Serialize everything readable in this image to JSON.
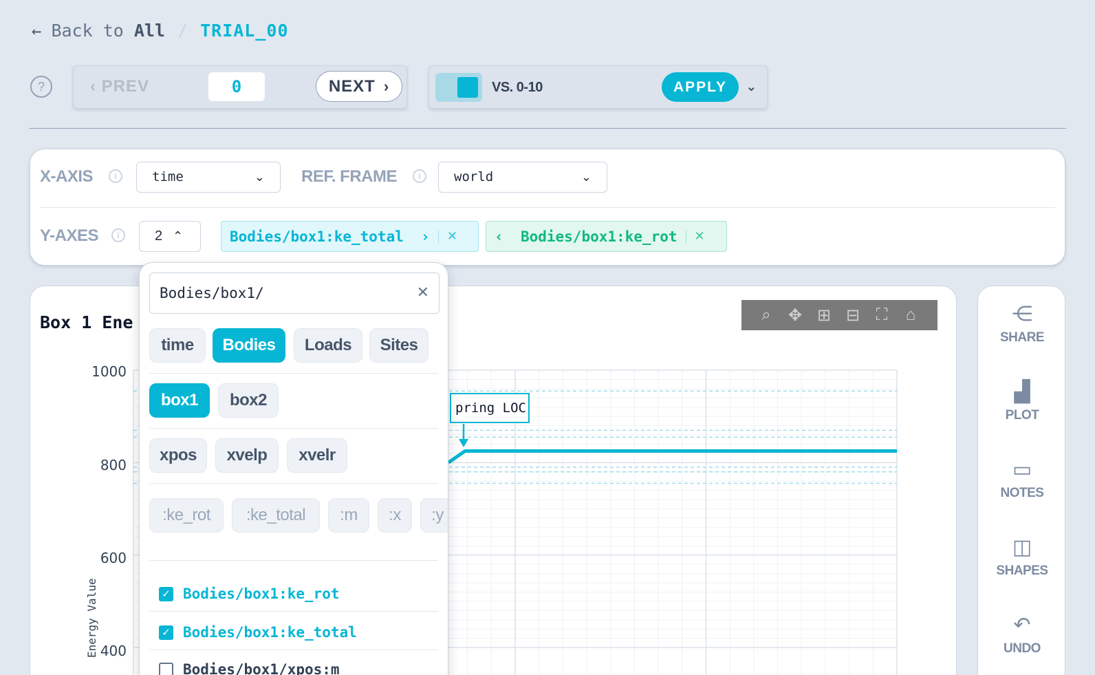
{
  "breadcrumb": {
    "back_prefix": "Back to",
    "back_target": "All",
    "separator": "/",
    "trial": "TRIAL_00"
  },
  "navigator": {
    "prev_label": "PREV",
    "index_value": "0",
    "next_label": "NEXT"
  },
  "compare": {
    "vs_label": "VS. 0-10",
    "apply_label": "APPLY"
  },
  "axes": {
    "x_label": "X-AXIS",
    "x_value": "time",
    "ref_label": "REF. FRAME",
    "ref_value": "world",
    "y_label": "Y-AXES",
    "y_count": "2",
    "y_tags": [
      "Bodies/box1:ke_total",
      "Bodies/box1:ke_rot"
    ]
  },
  "chart": {
    "title": "Box 1 Ene",
    "annotation": "pring LOC",
    "ylabel": "Energy Value",
    "yticks": [
      "1000",
      "800",
      "600",
      "400"
    ]
  },
  "chart_data": {
    "type": "line",
    "title": "Box 1 Ene",
    "ylabel": "Energy Value",
    "ylim": [
      400,
      1000
    ],
    "yticks": [
      1000,
      800,
      600,
      400
    ],
    "series": [
      {
        "values": [
          800,
          825,
          825,
          825,
          825,
          825
        ]
      }
    ]
  },
  "toolbar_icons": [
    "zoom-icon",
    "pan-icon",
    "zoom-in-icon",
    "zoom-out-icon",
    "autoscale-icon",
    "home-icon"
  ],
  "rail": {
    "share": "SHARE",
    "plot": "PLOT",
    "notes": "NOTES",
    "shapes": "SHAPES",
    "undo": "UNDO"
  },
  "dropdown": {
    "search_value": "Bodies/box1/",
    "level1": [
      "time",
      "Bodies",
      "Loads",
      "Sites"
    ],
    "level2": [
      "box1",
      "box2"
    ],
    "level3": [
      "xpos",
      "xvelp",
      "xvelr"
    ],
    "level4": [
      ":ke_rot",
      ":ke_total",
      ":m",
      ":x",
      ":y"
    ],
    "checks": [
      {
        "label": "Bodies/box1:ke_rot",
        "checked": true
      },
      {
        "label": "Bodies/box1:ke_total",
        "checked": true
      },
      {
        "label": "Bodies/box1/xpos:m",
        "checked": false
      }
    ]
  },
  "colors": {
    "accent": "#06b6d4",
    "accent_green": "#10b981",
    "muted": "#94a3b8"
  }
}
